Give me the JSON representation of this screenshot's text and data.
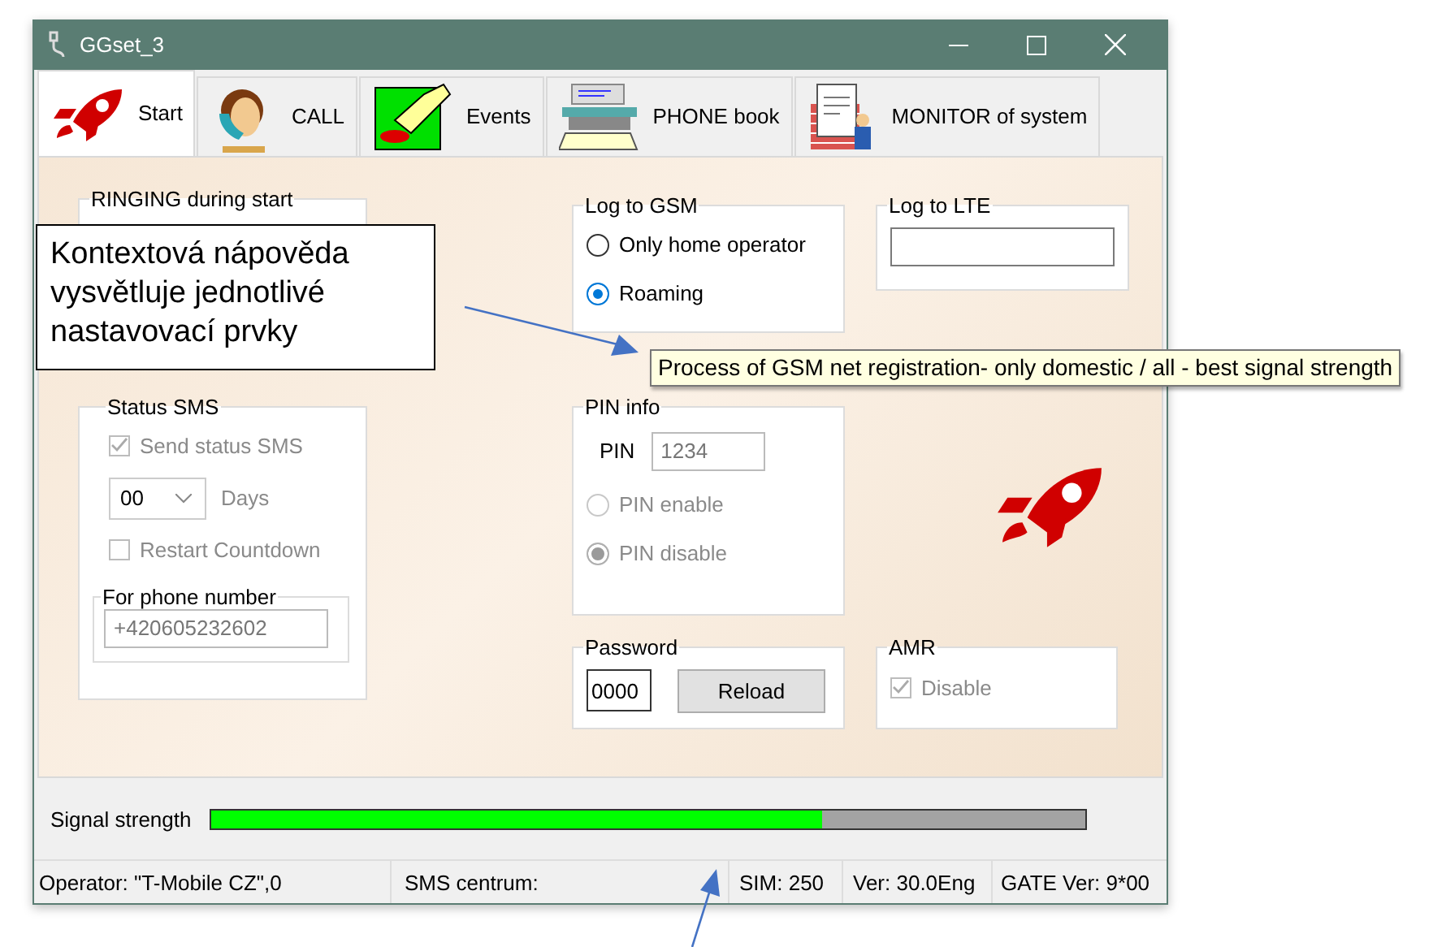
{
  "window": {
    "title": "GGset_3"
  },
  "tabs": [
    {
      "label": "Start",
      "selected": true
    },
    {
      "label": "CALL",
      "selected": false
    },
    {
      "label": "Events",
      "selected": false
    },
    {
      "label": "PHONE book",
      "selected": false
    },
    {
      "label": "MONITOR of system",
      "selected": false
    }
  ],
  "ringing_group": {
    "title": "RINGING during start"
  },
  "log_to_gsm": {
    "title": "Log to GSM",
    "options": [
      {
        "label": "Only home operator",
        "selected": false
      },
      {
        "label": "Roaming",
        "selected": true
      }
    ]
  },
  "log_to_lte": {
    "title": "Log to LTE"
  },
  "status_sms": {
    "title": "Status SMS",
    "send_status": {
      "label": "Send status SMS",
      "checked": true,
      "disabled": true
    },
    "days": {
      "value": "00",
      "label": "Days"
    },
    "restart": {
      "label": "Restart Countdown",
      "checked": false,
      "disabled": true
    },
    "phone": {
      "title": "For phone number",
      "value": "+420605232602"
    }
  },
  "pin_info": {
    "title": "PIN info",
    "pin_label": "PIN",
    "pin_value": "1234",
    "options": [
      {
        "label": "PIN enable",
        "selected": false,
        "disabled": true
      },
      {
        "label": "PIN disable",
        "selected": true,
        "disabled": true
      }
    ]
  },
  "password": {
    "title": "Password",
    "value": "0000",
    "button": "Reload"
  },
  "amr": {
    "title": "AMR",
    "checkbox": {
      "label": "Disable",
      "checked": true,
      "disabled": true
    }
  },
  "signal": {
    "label": "Signal strength",
    "level": 0.7
  },
  "status_bar": [
    {
      "text": "Operator: \"T-Mobile CZ\",0"
    },
    {
      "text": "SMS centrum:"
    },
    {
      "text": "SIM: 250"
    },
    {
      "text": "Ver: 30.0Eng"
    },
    {
      "text": "GATE Ver: 9*00"
    }
  ],
  "callout": {
    "text": "Kontextová nápověda vysvětluje jednotlivé nastavovací prvky"
  },
  "tooltip": {
    "text": "Process of GSM net registration- only domestic / all - best signal strength"
  }
}
